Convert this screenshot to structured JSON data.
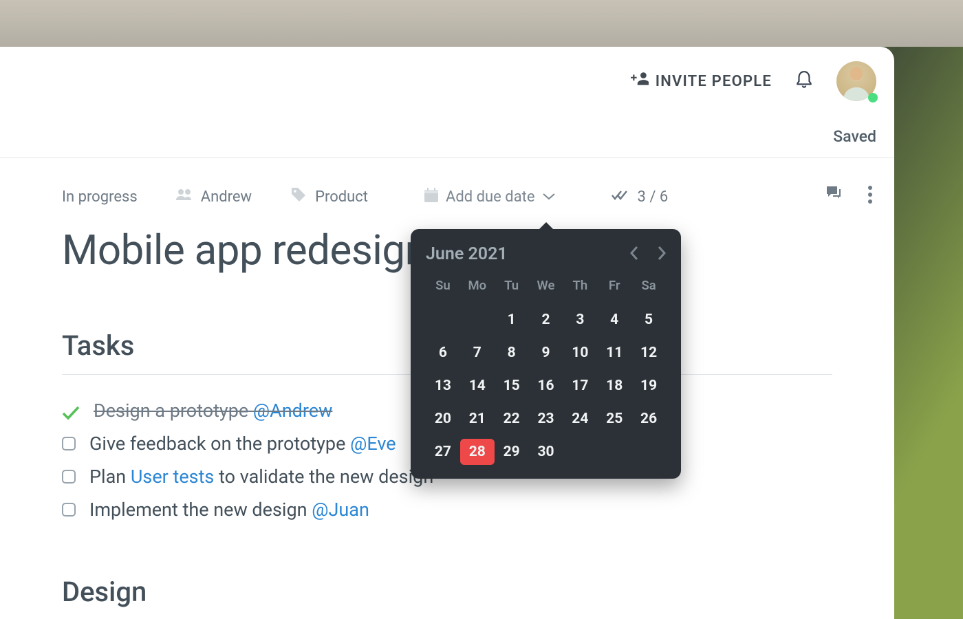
{
  "topbar": {
    "invite_label": "INVITE PEOPLE",
    "saved_label": "Saved"
  },
  "meta": {
    "status": "In progress",
    "assignee": "Andrew",
    "tag": "Product",
    "due_label": "Add due date",
    "progress": "3 / 6"
  },
  "page": {
    "title": "Mobile app redesign"
  },
  "sections": {
    "tasks_title": "Tasks",
    "design_title": "Design"
  },
  "tasks": [
    {
      "done": true,
      "text": "Design a prototype ",
      "mention": "@Andrew"
    },
    {
      "done": false,
      "text": "Give feedback on the prototype ",
      "mention": "@Eve"
    },
    {
      "done": false,
      "text_before": "Plan ",
      "link_text": "User tests",
      "text_after": " to validate the new design"
    },
    {
      "done": false,
      "text": "Implement the new design ",
      "mention": "@Juan"
    }
  ],
  "calendar": {
    "month_label": "June 2021",
    "dow": [
      "Su",
      "Mo",
      "Tu",
      "We",
      "Th",
      "Fr",
      "Sa"
    ],
    "leading_blanks": 2,
    "days": 30,
    "selected_day": 28
  },
  "colors": {
    "accent_red": "#ee4848",
    "link_blue": "#2b86d4",
    "check_green": "#54c157"
  }
}
